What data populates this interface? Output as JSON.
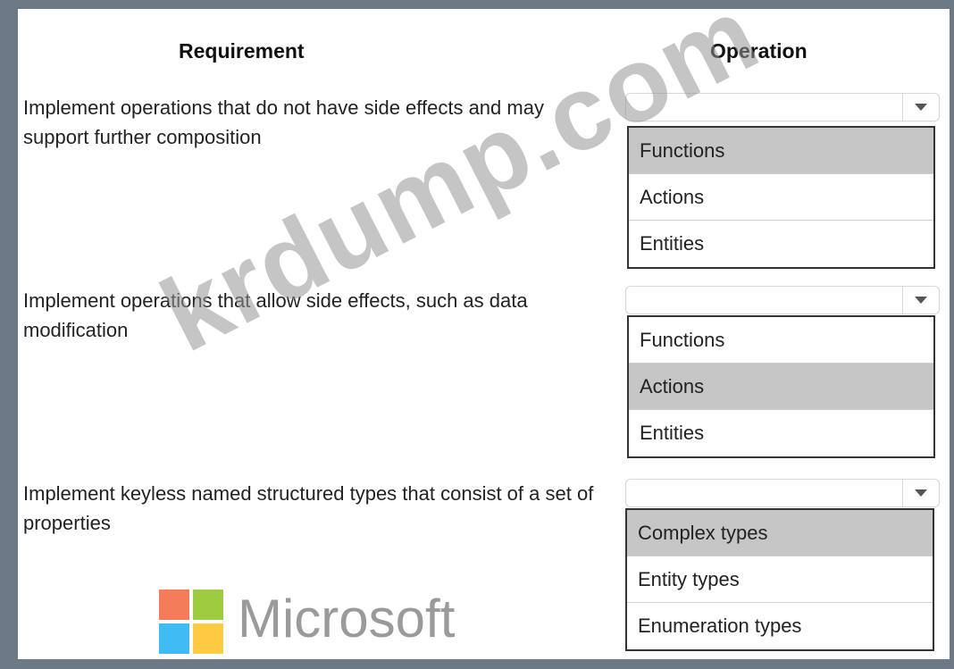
{
  "headers": {
    "requirement": "Requirement",
    "operation": "Operation"
  },
  "rows": [
    {
      "requirement": "Implement operations that do not have side effects and may support further composition",
      "options": [
        "Functions",
        "Actions",
        "Entities"
      ],
      "selected_index": 0
    },
    {
      "requirement": "Implement operations that allow side effects, such as data modification",
      "options": [
        "Functions",
        "Actions",
        "Entities"
      ],
      "selected_index": 1
    },
    {
      "requirement": "Implement keyless named structured types that consist of a set of properties",
      "options": [
        "Complex types",
        "Entity types",
        "Enumeration types"
      ],
      "selected_index": 0
    }
  ],
  "watermark": "krdump.com",
  "logo": {
    "text": "Microsoft",
    "colors": [
      "#f25022",
      "#7fba00",
      "#00a4ef",
      "#ffb900"
    ]
  }
}
